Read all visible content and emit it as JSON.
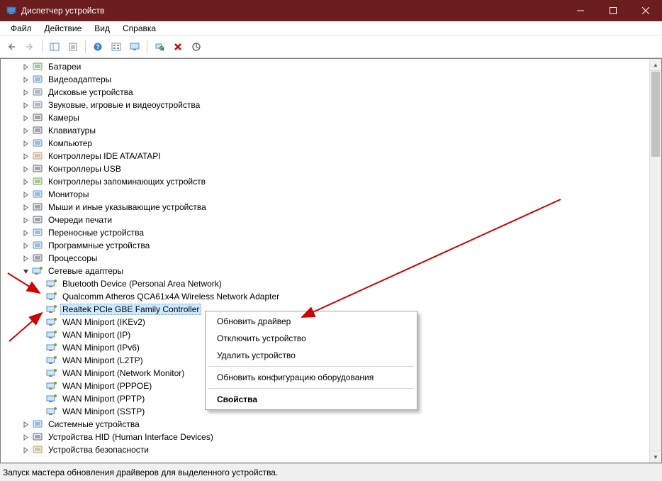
{
  "window": {
    "title": "Диспетчер устройств"
  },
  "menu": {
    "file": "Файл",
    "action": "Действие",
    "view": "Вид",
    "help": "Справка"
  },
  "toolbar": {
    "back": "back",
    "forward": "forward",
    "show_hide": "show-hide",
    "help": "help",
    "icons": "icons",
    "monitor": "monitor",
    "scan": "scan",
    "remove": "remove",
    "refresh": "refresh"
  },
  "tree": {
    "categories": [
      {
        "label": "Батареи",
        "icon": "battery"
      },
      {
        "label": "Видеоадаптеры",
        "icon": "display"
      },
      {
        "label": "Дисковые устройства",
        "icon": "disk"
      },
      {
        "label": "Звуковые, игровые и видеоустройства",
        "icon": "audio"
      },
      {
        "label": "Камеры",
        "icon": "camera"
      },
      {
        "label": "Клавиатуры",
        "icon": "keyboard"
      },
      {
        "label": "Компьютер",
        "icon": "computer"
      },
      {
        "label": "Контроллеры IDE ATA/ATAPI",
        "icon": "ide"
      },
      {
        "label": "Контроллеры USB",
        "icon": "usb"
      },
      {
        "label": "Контроллеры запоминающих устройств",
        "icon": "storage"
      },
      {
        "label": "Мониторы",
        "icon": "monitor"
      },
      {
        "label": "Мыши и иные указывающие устройства",
        "icon": "mouse"
      },
      {
        "label": "Очереди печати",
        "icon": "printer"
      },
      {
        "label": "Переносные устройства",
        "icon": "portable"
      },
      {
        "label": "Программные устройства",
        "icon": "software"
      },
      {
        "label": "Процессоры",
        "icon": "cpu"
      }
    ],
    "network": {
      "label": "Сетевые адаптеры",
      "children": [
        {
          "label": "Bluetooth Device (Personal Area Network)"
        },
        {
          "label": "Qualcomm Atheros QCA61x4A Wireless Network Adapter"
        },
        {
          "label": "Realtek PCIe GBE Family Controller",
          "selected": true
        },
        {
          "label": "WAN Miniport (IKEv2)"
        },
        {
          "label": "WAN Miniport (IP)"
        },
        {
          "label": "WAN Miniport (IPv6)"
        },
        {
          "label": "WAN Miniport (L2TP)"
        },
        {
          "label": "WAN Miniport (Network Monitor)"
        },
        {
          "label": "WAN Miniport (PPPOE)"
        },
        {
          "label": "WAN Miniport (PPTP)"
        },
        {
          "label": "WAN Miniport (SSTP)"
        }
      ]
    },
    "after": [
      {
        "label": "Системные устройства",
        "icon": "system"
      },
      {
        "label": "Устройства HID (Human Interface Devices)",
        "icon": "hid"
      },
      {
        "label": "Устройства безопасности",
        "icon": "security"
      }
    ]
  },
  "context": {
    "update": "Обновить драйвер",
    "disable": "Отключить устройство",
    "delete": "Удалить устройство",
    "rescan": "Обновить конфигурацию оборудования",
    "properties": "Свойства"
  },
  "status": {
    "text": "Запуск мастера обновления драйверов для выделенного устройства."
  }
}
